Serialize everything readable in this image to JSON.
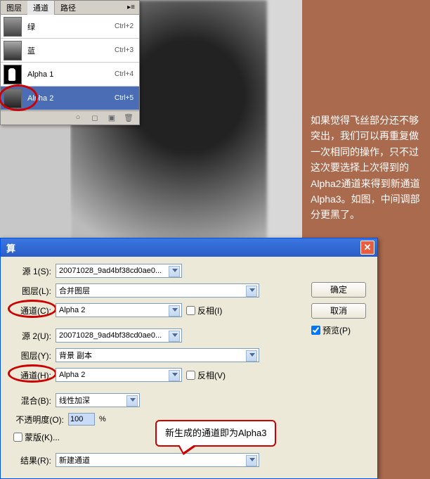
{
  "panel": {
    "tabs": [
      "图层",
      "通道",
      "路径"
    ],
    "channels": [
      {
        "name": "绿",
        "shortcut": "Ctrl+2"
      },
      {
        "name": "蓝",
        "shortcut": "Ctrl+3"
      },
      {
        "name": "Alpha 1",
        "shortcut": "Ctrl+4"
      },
      {
        "name": "Alpha 2",
        "shortcut": "Ctrl+5"
      }
    ]
  },
  "side_text": "如果觉得飞丝部分还不够突出，我们可以再重复做一次相同的操作，只不过这次要选择上次得到的Alpha2通道来得到新通道Alpha3。如图，中间调部分更黑了。",
  "dialog": {
    "title": "算",
    "source1_label": "源 1(S):",
    "source1_value": "20071028_9ad4bf38cd0ae0...",
    "layer1_label": "图层(L):",
    "layer1_value": "合并图层",
    "channel1_label": "通道(C):",
    "channel1_value": "Alpha 2",
    "invert1_label": "反相(I)",
    "source2_label": "源 2(U):",
    "source2_value": "20071028_9ad4bf38cd0ae0...",
    "layer2_label": "图层(Y):",
    "layer2_value": "背景 副本",
    "channel2_label": "通道(H):",
    "channel2_value": "Alpha 2",
    "invert2_label": "反相(V)",
    "blend_label": "混合(B):",
    "blend_value": "线性加深",
    "opacity_label": "不透明度(O):",
    "opacity_value": "100",
    "opacity_unit": "%",
    "mask_label": "蒙版(K)...",
    "result_label": "结果(R):",
    "result_value": "新建通道",
    "ok_label": "确定",
    "cancel_label": "取消",
    "preview_label": "预览(P)"
  },
  "callout_text": "新生成的通道即为Alpha3"
}
